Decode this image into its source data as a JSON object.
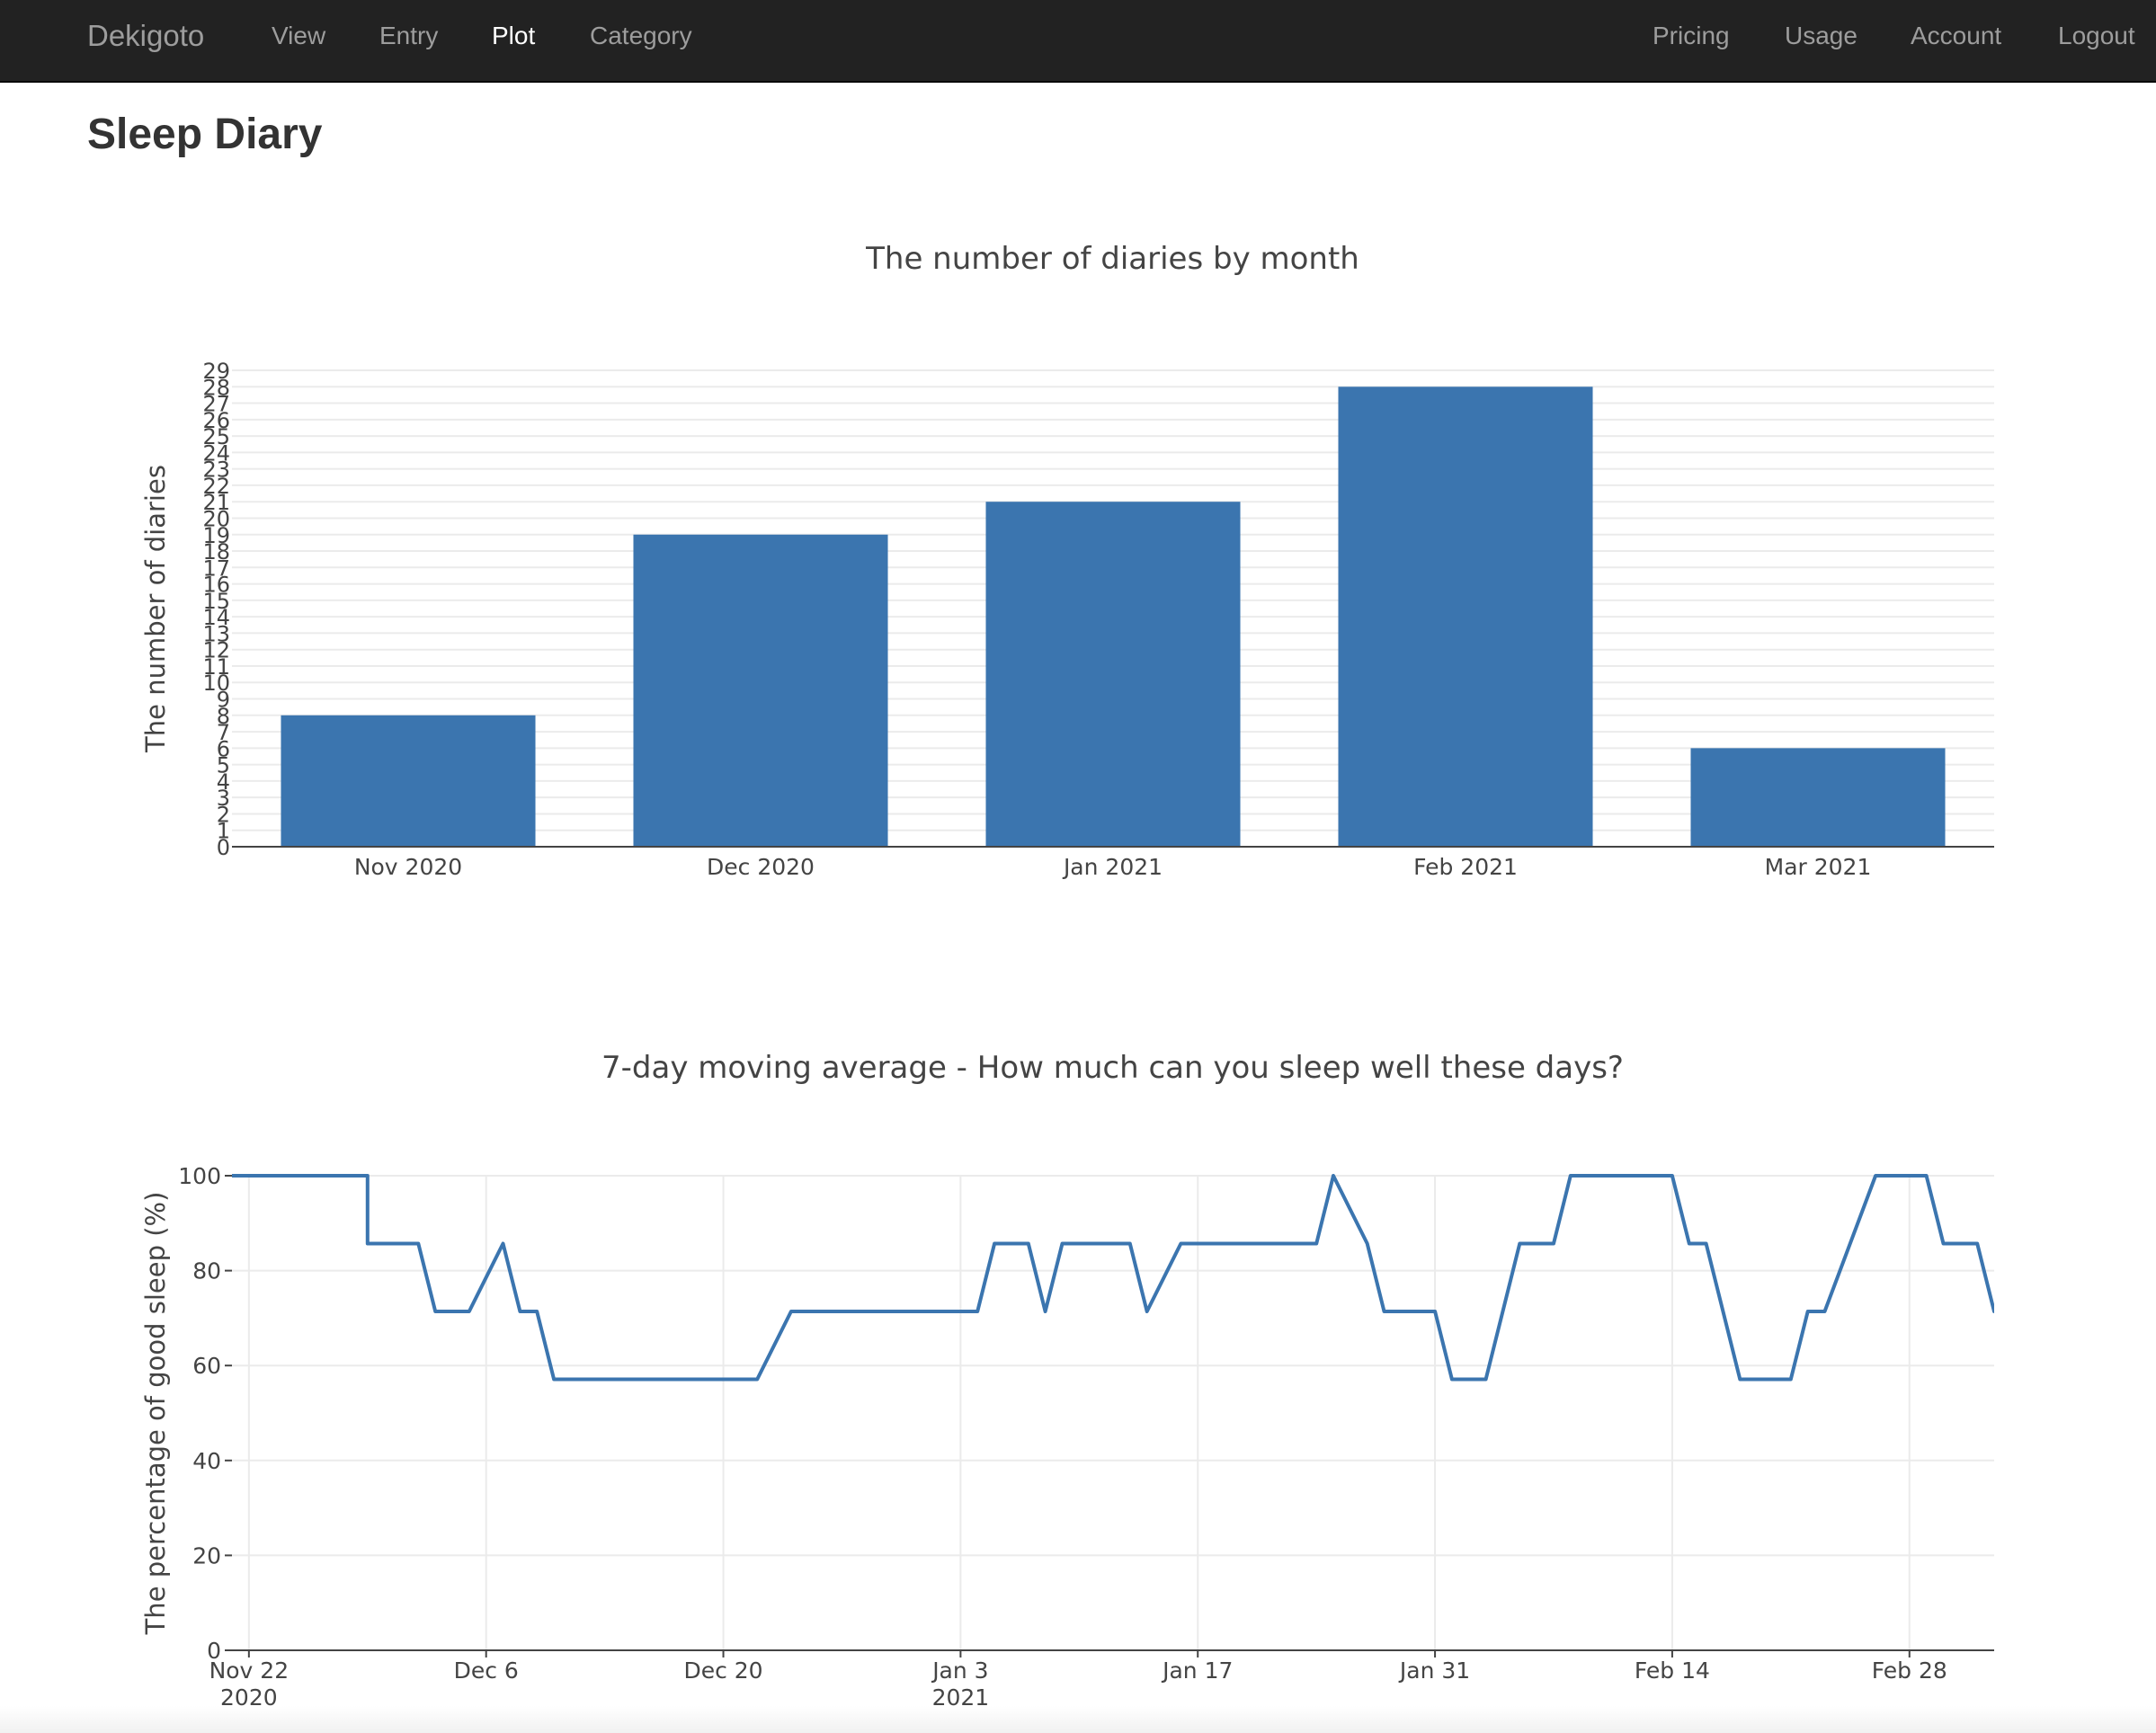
{
  "navbar": {
    "brand": "Dekigoto",
    "left_items": [
      {
        "label": "View",
        "active": false
      },
      {
        "label": "Entry",
        "active": false
      },
      {
        "label": "Plot",
        "active": true
      },
      {
        "label": "Category",
        "active": false
      }
    ],
    "right_items": [
      {
        "label": "Pricing"
      },
      {
        "label": "Usage"
      },
      {
        "label": "Account"
      },
      {
        "label": "Logout"
      }
    ]
  },
  "page": {
    "title": "Sleep Diary"
  },
  "colors": {
    "bar": "#3b75af",
    "line": "#3b75af",
    "navbar_bg": "#222222"
  },
  "chart_data": [
    {
      "type": "bar",
      "title": "The number of diaries by month",
      "xlabel": "",
      "ylabel": "The number of diaries",
      "categories": [
        "Nov 2020",
        "Dec 2020",
        "Jan 2021",
        "Feb 2021",
        "Mar 2021"
      ],
      "values": [
        8,
        19,
        21,
        28,
        6
      ],
      "ylim": [
        0,
        29
      ],
      "yticks": [
        0,
        1,
        2,
        3,
        4,
        5,
        6,
        7,
        8,
        9,
        10,
        11,
        12,
        13,
        14,
        15,
        16,
        17,
        18,
        19,
        20,
        21,
        22,
        23,
        24,
        25,
        26,
        27,
        28,
        29
      ],
      "grid": true,
      "legend": "none"
    },
    {
      "type": "line",
      "title": "7-day moving average - How much can you sleep well these days?",
      "xlabel": "",
      "ylabel": "The percentage of good sleep (%)",
      "ylim": [
        0,
        100
      ],
      "yticks": [
        0,
        20,
        40,
        60,
        80,
        100
      ],
      "xlim": [
        "2020-11-21",
        "2021-03-05"
      ],
      "xticks": [
        {
          "date": "2020-11-22",
          "label": "Nov 22",
          "sublabel": "2020"
        },
        {
          "date": "2020-12-06",
          "label": "Dec 6",
          "sublabel": ""
        },
        {
          "date": "2020-12-20",
          "label": "Dec 20",
          "sublabel": ""
        },
        {
          "date": "2021-01-03",
          "label": "Jan 3",
          "sublabel": "2021"
        },
        {
          "date": "2021-01-17",
          "label": "Jan 17",
          "sublabel": ""
        },
        {
          "date": "2021-01-31",
          "label": "Jan 31",
          "sublabel": ""
        },
        {
          "date": "2021-02-14",
          "label": "Feb 14",
          "sublabel": ""
        },
        {
          "date": "2021-02-28",
          "label": "Feb 28",
          "sublabel": ""
        }
      ],
      "grid": true,
      "legend": "none",
      "series": [
        {
          "x": [
            "2020-11-21",
            "2020-11-29",
            "2020-11-29",
            "2020-12-02",
            "2020-12-03",
            "2020-12-05",
            "2020-12-07",
            "2020-12-08",
            "2020-12-09",
            "2020-12-10",
            "2020-12-22",
            "2020-12-24",
            "2021-01-04",
            "2021-01-05",
            "2021-01-07",
            "2021-01-08",
            "2021-01-09",
            "2021-01-13",
            "2021-01-14",
            "2021-01-16",
            "2021-01-24",
            "2021-01-25",
            "2021-01-27",
            "2021-01-28",
            "2021-01-31",
            "2021-02-01",
            "2021-02-03",
            "2021-02-05",
            "2021-02-07",
            "2021-02-08",
            "2021-02-14",
            "2021-02-15",
            "2021-02-16",
            "2021-02-18",
            "2021-02-21",
            "2021-02-22",
            "2021-02-23",
            "2021-02-26",
            "2021-03-01",
            "2021-03-02",
            "2021-03-04",
            "2021-03-05",
            "2021-03-06"
          ],
          "y": [
            100,
            100,
            85.7,
            85.7,
            71.4,
            71.4,
            85.7,
            71.4,
            71.4,
            57.1,
            57.1,
            71.4,
            71.4,
            85.7,
            85.7,
            71.4,
            85.7,
            85.7,
            71.4,
            85.7,
            85.7,
            100,
            85.7,
            71.4,
            71.4,
            57.1,
            57.1,
            85.7,
            85.7,
            100,
            100,
            85.7,
            85.7,
            57.1,
            57.1,
            71.4,
            71.4,
            100,
            100,
            85.7,
            85.7,
            71.4,
            71.4
          ]
        }
      ]
    }
  ]
}
